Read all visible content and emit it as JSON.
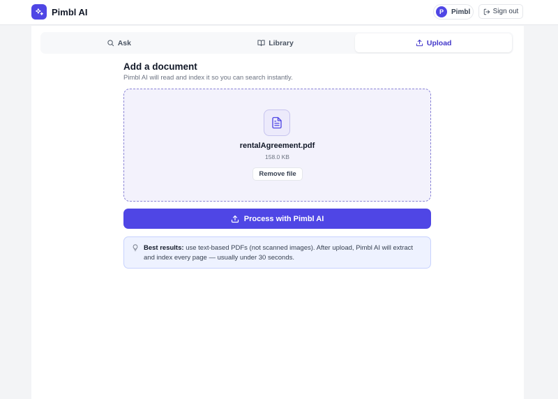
{
  "app": {
    "name": "Pimbl AI"
  },
  "user": {
    "initial": "P",
    "name": "Pimbl"
  },
  "header": {
    "signout_label": "Sign out"
  },
  "tabs": [
    {
      "label": "Ask",
      "icon": "search-icon",
      "active": false
    },
    {
      "label": "Library",
      "icon": "book-icon",
      "active": false
    },
    {
      "label": "Upload",
      "icon": "upload-icon",
      "active": true
    }
  ],
  "upload": {
    "title": "Add a document",
    "subtitle": "Pimbl AI will read and index it so you can search instantly.",
    "file": {
      "name": "rentalAgreement.pdf",
      "size": "158.0 KB",
      "icon": "file-text-icon"
    },
    "remove_label": "Remove file",
    "process_label": "Process with Pimbl AI"
  },
  "tip": {
    "icon": "lightbulb-icon",
    "bold": "Best results:",
    "text": " use text-based PDFs (not scanned images). After upload, Pimbl AI will extract and index every page — usually under 30 seconds."
  },
  "colors": {
    "accent": "#4f46e5",
    "dropzone_bg": "#f3f2fc",
    "tip_bg": "#eef2ff"
  }
}
